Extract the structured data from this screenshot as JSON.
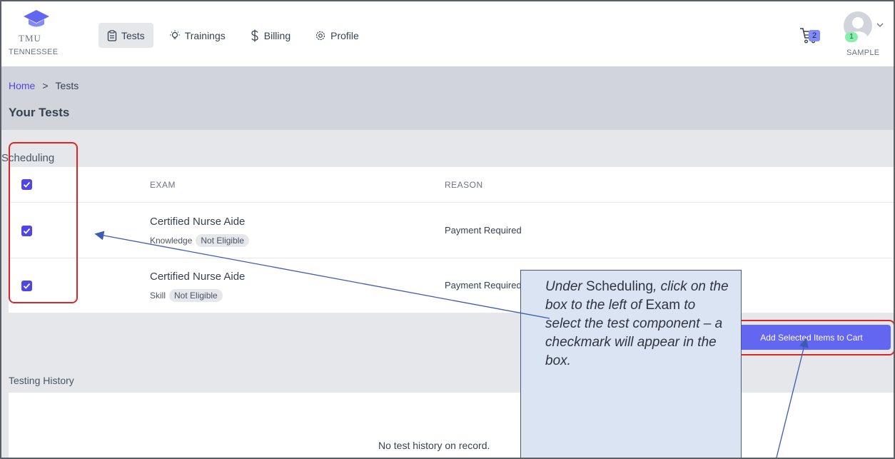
{
  "logo": {
    "tmu": "TMU",
    "state": "TENNESSEE"
  },
  "nav": {
    "items": [
      {
        "label": "Tests",
        "icon": "clipboard-icon",
        "active": true
      },
      {
        "label": "Trainings",
        "icon": "lightbulb-icon"
      },
      {
        "label": "Billing",
        "icon": "dollar-icon"
      },
      {
        "label": "Profile",
        "icon": "gear-icon"
      }
    ]
  },
  "cart": {
    "count": "2"
  },
  "user": {
    "badge": "1",
    "name": "SAMPLE"
  },
  "breadcrumb": {
    "home": "Home",
    "separator": ">",
    "current": "Tests"
  },
  "page_title": "Your Tests",
  "scheduling": {
    "label": "Scheduling",
    "columns": {
      "exam": "EXAM",
      "reason": "REASON"
    },
    "rows": [
      {
        "name": "Certified Nurse Aide",
        "component": "Knowledge",
        "status": "Not Eligible",
        "reason": "Payment Required",
        "checked": true
      },
      {
        "name": "Certified Nurse Aide",
        "component": "Skill",
        "status": "Not Eligible",
        "reason": "Payment Required",
        "checked": true
      }
    ],
    "add_button": "Add Selected Items to Cart"
  },
  "history": {
    "label": "Testing History",
    "empty": "No test history on record."
  },
  "annotation": {
    "p1": "Under ",
    "k1": "Scheduling",
    "p2": ", click on the box to the left of ",
    "k2": "Exam",
    "p3": " to select the test component – a checkmark will appear in the box."
  },
  "colors": {
    "accent": "#4f46e5",
    "button": "#6366f1",
    "annotation_red": "#dc2626",
    "callout_bg": "#dbe4f2"
  }
}
